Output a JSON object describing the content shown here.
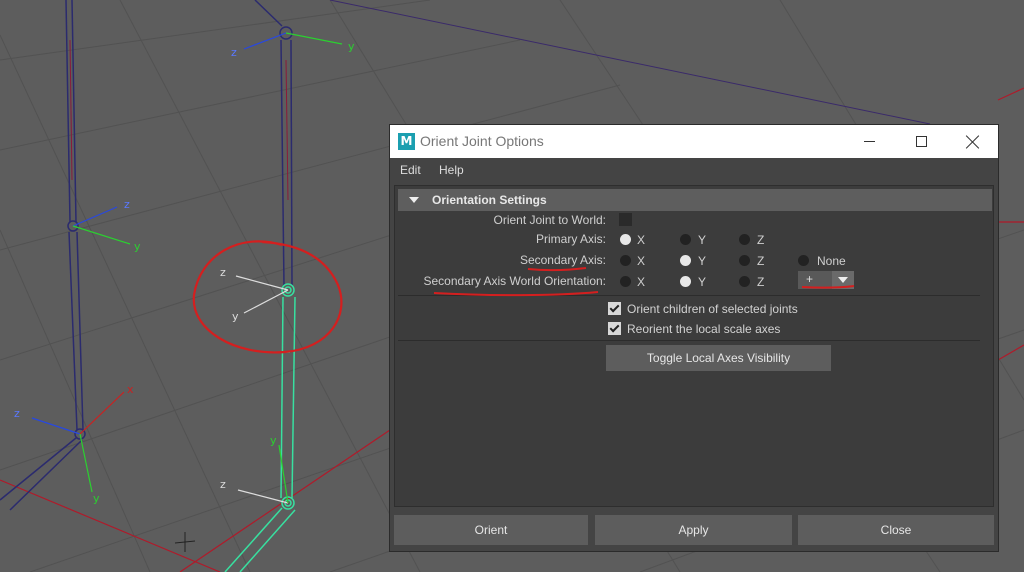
{
  "window": {
    "title": "Orient Joint Options",
    "app_icon_letter": "M"
  },
  "menu": {
    "items": [
      "Edit",
      "Help"
    ]
  },
  "section": {
    "title": "Orientation Settings"
  },
  "options": {
    "orient_to_world_label": "Orient Joint to World:",
    "orient_to_world_checked": false,
    "primary_axis": {
      "label": "Primary Axis:",
      "choices": [
        "X",
        "Y",
        "Z"
      ],
      "selected": "X"
    },
    "secondary_axis": {
      "label": "Secondary Axis:",
      "choices": [
        "X",
        "Y",
        "Z",
        "None"
      ],
      "selected": "Y"
    },
    "secondary_world_orientation": {
      "label": "Secondary Axis World Orientation:",
      "choices": [
        "X",
        "Y",
        "Z"
      ],
      "selected": "Y",
      "sign": "+"
    },
    "orient_children": {
      "label": "Orient children of selected joints",
      "checked": true
    },
    "reorient_scale": {
      "label": "Reorient the local scale axes",
      "checked": true
    },
    "toggle_button": "Toggle Local Axes Visibility"
  },
  "footer": {
    "orient": "Orient",
    "apply": "Apply",
    "close": "Close"
  },
  "viewport": {
    "axis_labels": {
      "x": "x",
      "y": "y",
      "z": "z"
    }
  },
  "colors": {
    "grid": "#505050",
    "bone_blue": "#2b2b6e",
    "bone_selected": "#38e0a0",
    "axis_x": "#cc2020",
    "axis_y": "#2bd030",
    "axis_z": "#2848e0",
    "annotation_red": "#d41f1f"
  }
}
